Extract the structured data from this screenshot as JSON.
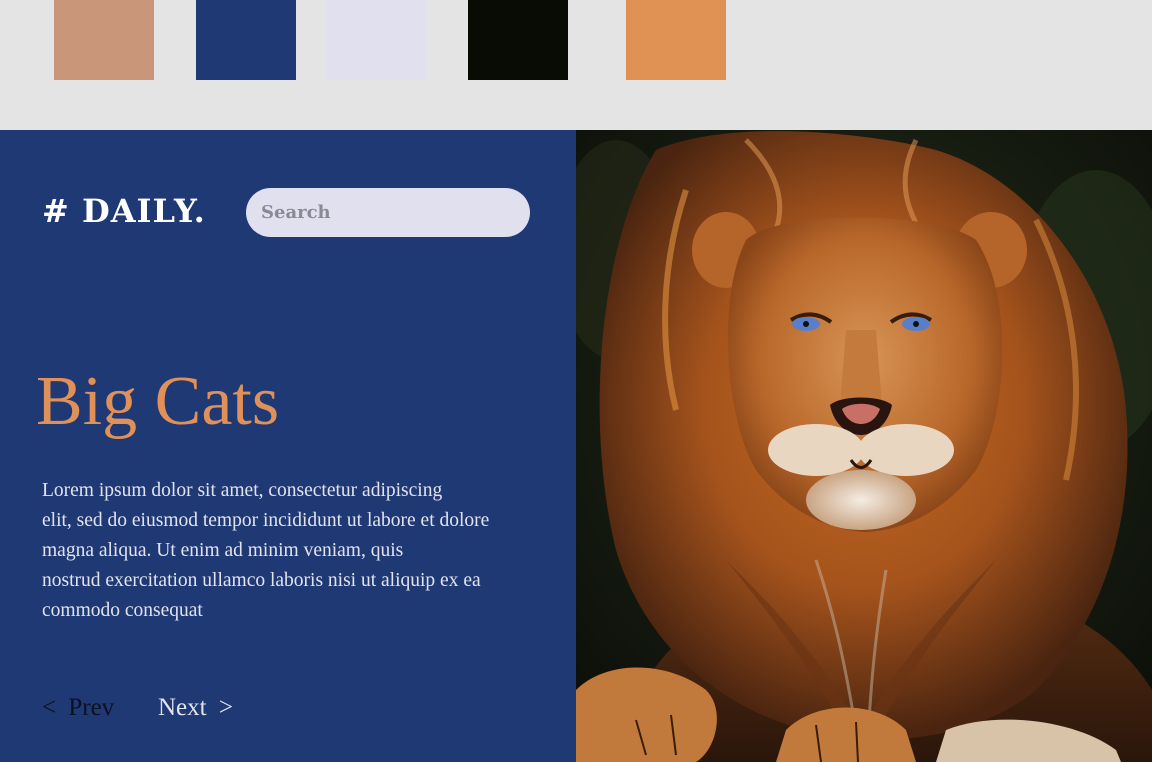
{
  "palette": {
    "colors": [
      "#c99679",
      "#1f3975",
      "#e0e0ee",
      "#090c04",
      "#e09154"
    ]
  },
  "header": {
    "logo": "# DAILY.",
    "search_placeholder": "Search"
  },
  "article": {
    "title": "Big Cats",
    "body": "Lorem ipsum dolor sit amet, consectetur adipiscing\nelit, sed do eiusmod tempor incididunt ut labore et dolore\n magna aliqua. Ut enim ad minim veniam, quis\nnostrud exercitation ullamco laboris nisi ut aliquip ex ea\ncommodo consequat"
  },
  "nav": {
    "prev_arrow": "<",
    "prev_label": "Prev",
    "next_label": "Next",
    "next_arrow": ">"
  },
  "colors": {
    "panel": "#1f3975",
    "accent": "#e0915a",
    "text": "#e3e3f0",
    "canvas": "#e4e4e4"
  },
  "image": {
    "subject": "lion-portrait"
  }
}
